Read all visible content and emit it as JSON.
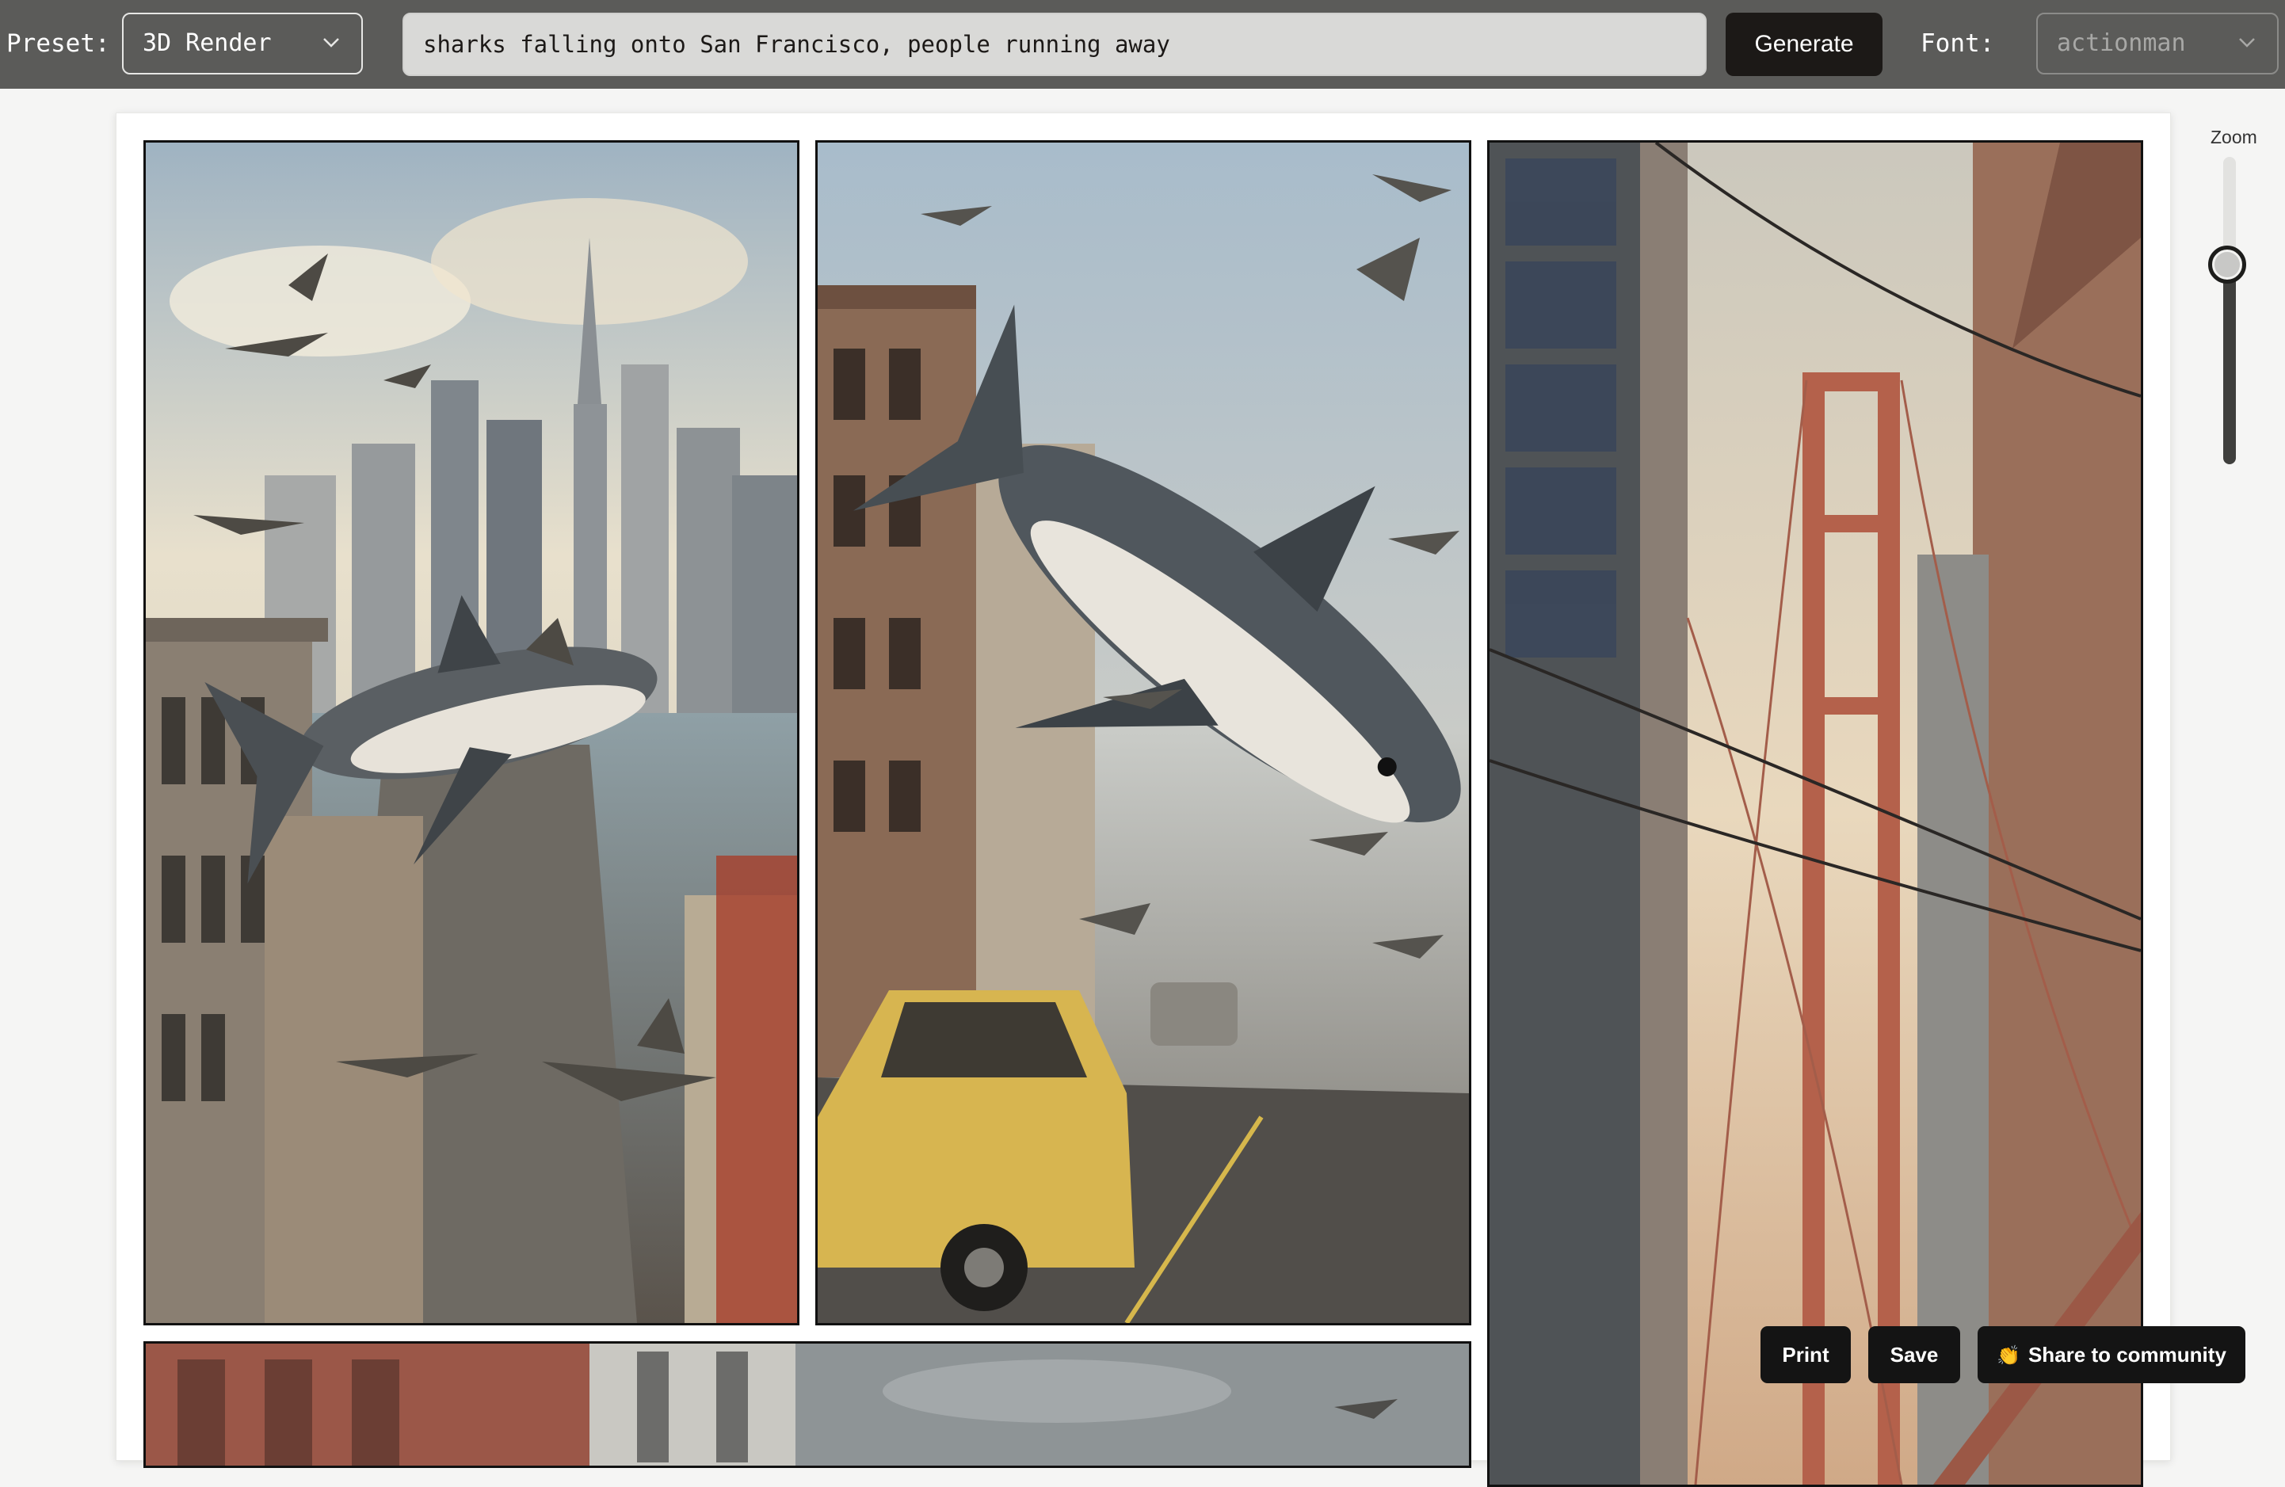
{
  "toolbar": {
    "preset_label": "Preset:",
    "preset_value": "3D Render",
    "prompt_value": "sharks falling onto San Francisco, people running away",
    "generate_label": "Generate",
    "font_label": "Font:",
    "font_value": "actionman"
  },
  "zoom": {
    "label": "Zoom",
    "value_fraction": 0.65
  },
  "panels": [
    {
      "icon": "generated-image-sharks-city"
    },
    {
      "icon": "generated-image-shark-taxi"
    },
    {
      "icon": "generated-image-golden-gate"
    },
    {
      "icon": "generated-image-street-partial"
    }
  ],
  "actions": {
    "print_label": "Print",
    "save_label": "Save",
    "share_icon": "hand-emoji-icon",
    "share_glyph": "👏",
    "share_label": "Share to community"
  }
}
